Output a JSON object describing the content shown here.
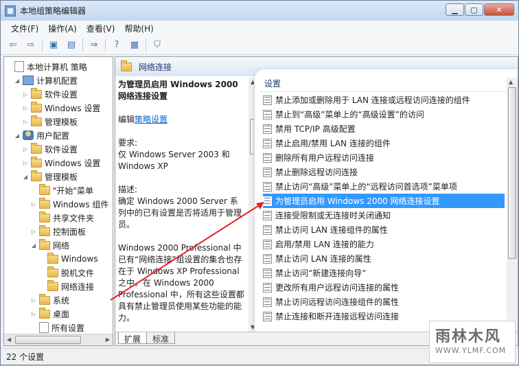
{
  "window": {
    "title": "本地组策略编辑器"
  },
  "menu": [
    {
      "label": "文件(F)"
    },
    {
      "label": "操作(A)"
    },
    {
      "label": "查看(V)"
    },
    {
      "label": "帮助(H)"
    }
  ],
  "toolbar": {
    "buttons": [
      {
        "icon": "back-icon",
        "glyph": "⇦"
      },
      {
        "icon": "forward-icon",
        "glyph": "⇨"
      },
      {
        "icon": "up-folder-icon",
        "glyph": "▣"
      },
      {
        "icon": "show-hide-tree-icon",
        "glyph": "▤"
      },
      {
        "icon": "export-list-icon",
        "glyph": "⇒"
      },
      {
        "icon": "help-icon",
        "glyph": "?"
      },
      {
        "icon": "properties-icon",
        "glyph": "▦"
      },
      {
        "icon": "filter-icon",
        "glyph": "⛉"
      }
    ]
  },
  "tree": [
    {
      "label": "本地计算机 策略",
      "icon": "doc",
      "level": 0,
      "expander": ""
    },
    {
      "label": "计算机配置",
      "icon": "comp",
      "level": 1,
      "expander": "◢"
    },
    {
      "label": "软件设置",
      "icon": "folder",
      "level": 2,
      "expander": "▷"
    },
    {
      "label": "Windows 设置",
      "icon": "folder",
      "level": 2,
      "expander": "▷"
    },
    {
      "label": "管理模板",
      "icon": "folder",
      "level": 2,
      "expander": "▷"
    },
    {
      "label": "用户配置",
      "icon": "user",
      "level": 1,
      "expander": "◢"
    },
    {
      "label": "软件设置",
      "icon": "folder",
      "level": 2,
      "expander": "▷"
    },
    {
      "label": "Windows 设置",
      "icon": "folder",
      "level": 2,
      "expander": "▷"
    },
    {
      "label": "管理模板",
      "icon": "folder",
      "level": 2,
      "expander": "◢"
    },
    {
      "label": "\"开始\"菜单",
      "icon": "folder",
      "level": 3,
      "expander": ""
    },
    {
      "label": "Windows 组件",
      "icon": "folder",
      "level": 3,
      "expander": "▷"
    },
    {
      "label": "共享文件夹",
      "icon": "folder",
      "level": 3,
      "expander": ""
    },
    {
      "label": "控制面板",
      "icon": "folder",
      "level": 3,
      "expander": "▷"
    },
    {
      "label": "网络",
      "icon": "folder",
      "level": 3,
      "expander": "◢"
    },
    {
      "label": "Windows",
      "icon": "folder",
      "level": 4,
      "expander": ""
    },
    {
      "label": "脱机文件",
      "icon": "folder",
      "level": 4,
      "expander": ""
    },
    {
      "label": "网络连接",
      "icon": "folder",
      "level": 4,
      "expander": ""
    },
    {
      "label": "系统",
      "icon": "folder",
      "level": 3,
      "expander": "▷"
    },
    {
      "label": "桌面",
      "icon": "folder",
      "level": 3,
      "expander": "▷"
    },
    {
      "label": "所有设置",
      "icon": "doc",
      "level": 3,
      "expander": ""
    }
  ],
  "header": {
    "title": "网络连接"
  },
  "description": {
    "title": "为管理员启用 Windows 2000 网络连接设置",
    "edit_prefix": "编辑",
    "edit_link": "策略设置",
    "requirements_label": "要求:",
    "requirements_text": "仅 Windows Server 2003 和 Windows XP",
    "description_label": "描述:",
    "description_text": "确定 Windows 2000 Server 系列中的已有设置是否将适用于管理员。",
    "description_text2": "Windows 2000 Professional 中已有“网络连接”组设置的集合也存在于 Windows XP Professional 之中。在 Windows 2000 Professional 中，所有这些设置都具有禁止管理员使用某些功能的能力。"
  },
  "list": {
    "column_title": "设置",
    "selected_index": 7,
    "items": [
      "禁止添加或删除用于 LAN 连接或远程访问连接的组件",
      "禁止到“高级”菜单上的“高级设置”的访问",
      "禁用 TCP/IP 高级配置",
      "禁止启用/禁用 LAN 连接的组件",
      "删除所有用户远程访问连接",
      "禁止删除远程访问连接",
      "禁止访问“高级”菜单上的“远程访问首选项”菜单项",
      "为管理员启用 Windows 2000 网络连接设置",
      "连接受限制或无连接时关闭通知",
      "禁止访问 LAN 连接组件的属性",
      "启用/禁用 LAN 连接的能力",
      "禁止访问 LAN 连接的属性",
      "禁止访问“新建连接向导”",
      "更改所有用户远程访问连接的属性",
      "禁止访问远程访问连接组件的属性",
      "禁止连接和断开连接远程访问连接"
    ]
  },
  "tabs": [
    {
      "label": "扩展"
    },
    {
      "label": "标准"
    }
  ],
  "status": {
    "text": "22 个设置"
  },
  "watermark": {
    "logo": "雨林木风",
    "url": "WWW.YLMF.COM"
  },
  "colors": {
    "selection": "#3399ff",
    "arrow": "#e0242a",
    "link": "#0066cc"
  }
}
